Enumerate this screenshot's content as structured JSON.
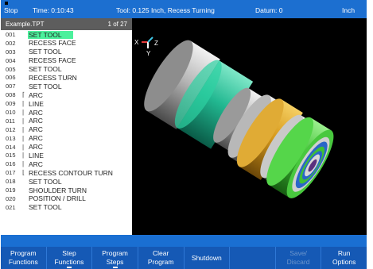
{
  "status": {
    "state": "Stop",
    "time": "Time: 0:10:43",
    "tool": "Tool: 0.125 Inch, Recess Turning",
    "datum": "Datum: 0",
    "units": "Inch"
  },
  "program": {
    "filename": "Example.TPT",
    "position": "1 of 27",
    "rows": [
      {
        "num": "001",
        "brace": "",
        "label": "SET TOOL"
      },
      {
        "num": "002",
        "brace": "",
        "label": "RECESS FACE"
      },
      {
        "num": "003",
        "brace": "",
        "label": "SET TOOL"
      },
      {
        "num": "004",
        "brace": "",
        "label": "RECESS FACE"
      },
      {
        "num": "005",
        "brace": "",
        "label": "SET TOOL"
      },
      {
        "num": "006",
        "brace": "",
        "label": "RECESS TURN"
      },
      {
        "num": "007",
        "brace": "",
        "label": "SET TOOL"
      },
      {
        "num": "008",
        "brace": "⌈",
        "label": "ARC"
      },
      {
        "num": "009",
        "brace": "|",
        "label": "LINE"
      },
      {
        "num": "010",
        "brace": "|",
        "label": "ARC"
      },
      {
        "num": "011",
        "brace": "|",
        "label": "ARC"
      },
      {
        "num": "012",
        "brace": "|",
        "label": "ARC"
      },
      {
        "num": "013",
        "brace": "|",
        "label": "ARC"
      },
      {
        "num": "014",
        "brace": "|",
        "label": "ARC"
      },
      {
        "num": "015",
        "brace": "|",
        "label": "LINE"
      },
      {
        "num": "016",
        "brace": "|",
        "label": "ARC"
      },
      {
        "num": "017",
        "brace": "⌊",
        "label": "RECESS CONTOUR TURN"
      },
      {
        "num": "018",
        "brace": "",
        "label": "SET TOOL"
      },
      {
        "num": "019",
        "brace": "",
        "label": "SHOULDER TURN"
      },
      {
        "num": "020",
        "brace": "",
        "label": "POSITION / DRILL"
      },
      {
        "num": "021",
        "brace": "",
        "label": "SET TOOL"
      }
    ]
  },
  "viewport": {
    "axis_x": "X",
    "axis_y": "Y",
    "axis_z": "Z",
    "colors": {
      "axis_x": "#e53b3b",
      "axis_y": "#ffffff",
      "axis_z": "#3fc8e8",
      "part_grey": "#a8a8a8",
      "part_teal": "#22b891",
      "part_gold": "#d79a1c",
      "part_green": "#3fbf35",
      "part_blue": "#2a66c8",
      "center_purple": "#5a2f7e"
    }
  },
  "softkeys": [
    {
      "line1": "Program",
      "line2": "Functions",
      "enabled": true,
      "dropdown": false
    },
    {
      "line1": "Step",
      "line2": "Functions",
      "enabled": true,
      "dropdown": true
    },
    {
      "line1": "Program",
      "line2": "Steps",
      "enabled": true,
      "dropdown": true
    },
    {
      "line1": "Clear",
      "line2": "Program",
      "enabled": true,
      "dropdown": false
    },
    {
      "line1": "Shutdown",
      "line2": "",
      "enabled": true,
      "dropdown": false
    },
    {
      "line1": "",
      "line2": "",
      "enabled": false,
      "dropdown": false
    },
    {
      "line1": "Save/",
      "line2": "Discard",
      "enabled": false,
      "dropdown": false
    },
    {
      "line1": "Run",
      "line2": "Options",
      "enabled": true,
      "dropdown": false
    }
  ]
}
